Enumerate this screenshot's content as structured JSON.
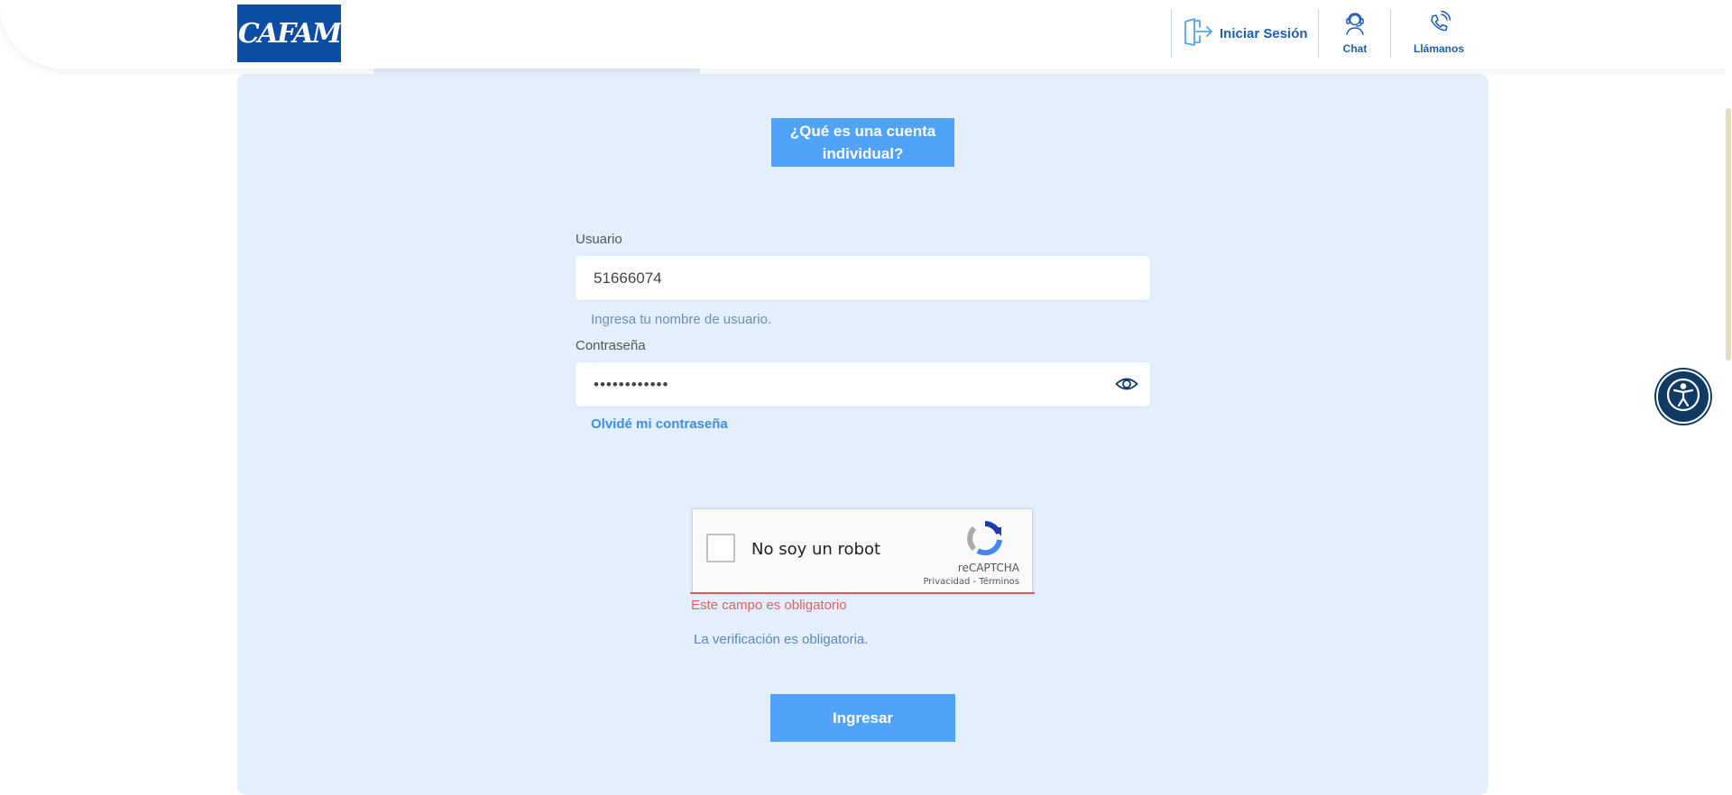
{
  "header": {
    "logo_text": "CAFAM",
    "login_label": "Iniciar Sesión",
    "chat_label": "Chat",
    "call_label": "Llámanos"
  },
  "main": {
    "info_button_label": "¿Qué es una cuenta individual?",
    "username": {
      "label": "Usuario",
      "value": "51666074",
      "hint": "Ingresa tu nombre de usuario."
    },
    "password": {
      "label": "Contraseña",
      "value": "••••••••••••",
      "forgot_link": "Olvidé mi contraseña"
    },
    "captcha": {
      "checkbox_label": "No soy un robot",
      "brand": "reCAPTCHA",
      "links": "Privacidad - Términos",
      "error": "Este campo es obligatorio"
    },
    "verification_note": "La verificación es obligatoria.",
    "submit_label": "Ingresar"
  },
  "colors": {
    "brand_blue": "#0a4da2",
    "accent_button": "#4fa3fb",
    "panel_bg": "#e3effc",
    "error_red": "#e46060"
  },
  "icons": [
    "login-door-icon",
    "chat-agent-icon",
    "phone-icon",
    "eye-icon",
    "recaptcha-icon",
    "accessibility-icon"
  ]
}
